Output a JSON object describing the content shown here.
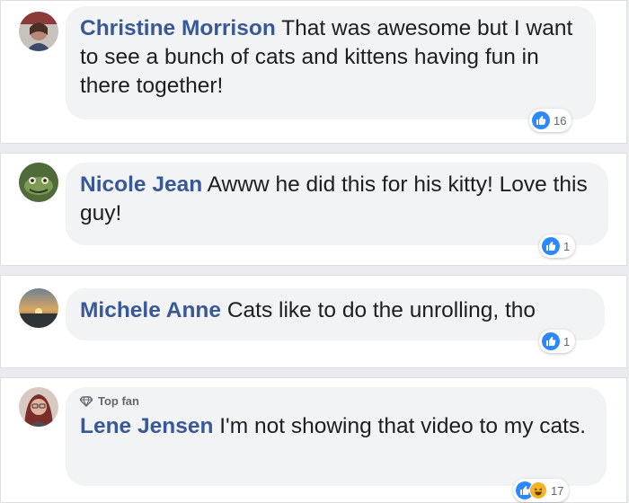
{
  "comments": [
    {
      "author": "Christine Morrison",
      "text": "That was awesome but I want to see a bunch of cats and kittens having fun in there together!",
      "reactions": {
        "types": [
          "like"
        ],
        "count": "16"
      },
      "top_fan": false
    },
    {
      "author": "Nicole Jean",
      "text": "Awww he did this for his kitty! Love this guy!",
      "reactions": {
        "types": [
          "like"
        ],
        "count": "1"
      },
      "top_fan": false
    },
    {
      "author": "Michele Anne",
      "text": "Cats like to do the unrolling, tho",
      "reactions": {
        "types": [
          "like"
        ],
        "count": "1"
      },
      "top_fan": false
    },
    {
      "author": "Lene Jensen",
      "text": "I'm not showing that video to my cats.",
      "reactions": {
        "types": [
          "like",
          "haha"
        ],
        "count": "17"
      },
      "top_fan": true,
      "badge_label": "Top fan"
    }
  ],
  "colors": {
    "author": "#385898",
    "like": "#2d88ff",
    "haha": "#f7b125",
    "bubble": "#f2f3f5"
  }
}
